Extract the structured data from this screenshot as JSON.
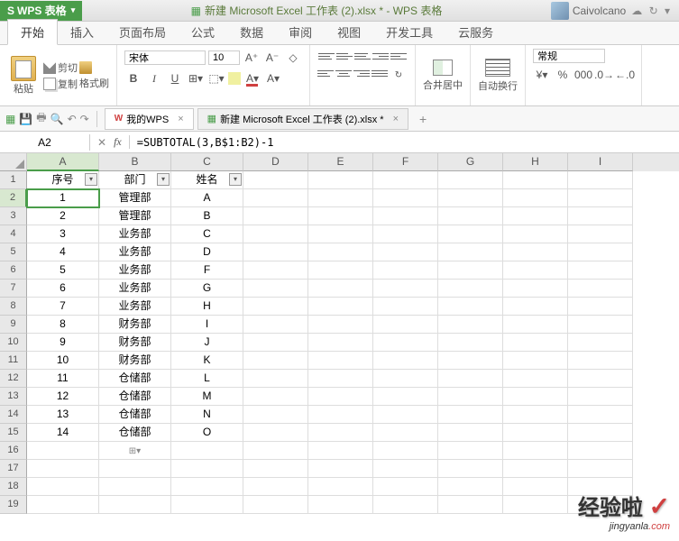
{
  "app": {
    "name": "WPS 表格",
    "title": "新建 Microsoft Excel 工作表 (2).xlsx * - WPS 表格",
    "user": "Caivolcano"
  },
  "menu": {
    "tabs": [
      "开始",
      "插入",
      "页面布局",
      "公式",
      "数据",
      "审阅",
      "视图",
      "开发工具",
      "云服务"
    ],
    "active": 0
  },
  "ribbon": {
    "paste": "粘贴",
    "cut": "剪切",
    "copy": "复制",
    "brush": "格式刷",
    "font_name": "宋体",
    "font_size": "10",
    "merge": "合井居中",
    "wrap": "自动换行",
    "format": "常规"
  },
  "doc_tabs": {
    "wps": "我的WPS",
    "file": "新建 Microsoft Excel 工作表 (2).xlsx *"
  },
  "formula": {
    "cell_ref": "A2",
    "fx": "fx",
    "value": "=SUBTOTAL(3,B$1:B2)-1"
  },
  "headers": {
    "A": "序号",
    "B": "部门",
    "C": "姓名"
  },
  "rows": [
    {
      "n": "1",
      "a": "1",
      "b": "管理部",
      "c": "A"
    },
    {
      "n": "2",
      "a": "2",
      "b": "管理部",
      "c": "B"
    },
    {
      "n": "3",
      "a": "3",
      "b": "业务部",
      "c": "C"
    },
    {
      "n": "4",
      "a": "4",
      "b": "业务部",
      "c": "D"
    },
    {
      "n": "5",
      "a": "5",
      "b": "业务部",
      "c": "F"
    },
    {
      "n": "6",
      "a": "6",
      "b": "业务部",
      "c": "G"
    },
    {
      "n": "7",
      "a": "7",
      "b": "业务部",
      "c": "H"
    },
    {
      "n": "8",
      "a": "8",
      "b": "财务部",
      "c": "I"
    },
    {
      "n": "9",
      "a": "9",
      "b": "财务部",
      "c": "J"
    },
    {
      "n": "10",
      "a": "10",
      "b": "财务部",
      "c": "K"
    },
    {
      "n": "11",
      "a": "11",
      "b": "仓储部",
      "c": "L"
    },
    {
      "n": "12",
      "a": "12",
      "b": "仓储部",
      "c": "M"
    },
    {
      "n": "13",
      "a": "13",
      "b": "仓储部",
      "c": "N"
    },
    {
      "n": "14",
      "a": "14",
      "b": "仓储部",
      "c": "O"
    }
  ],
  "cols": [
    "A",
    "B",
    "C",
    "D",
    "E",
    "F",
    "G",
    "H",
    "I"
  ],
  "watermark": {
    "main": "经验啦",
    "sub": "jingyanla",
    "dom": ".com"
  }
}
